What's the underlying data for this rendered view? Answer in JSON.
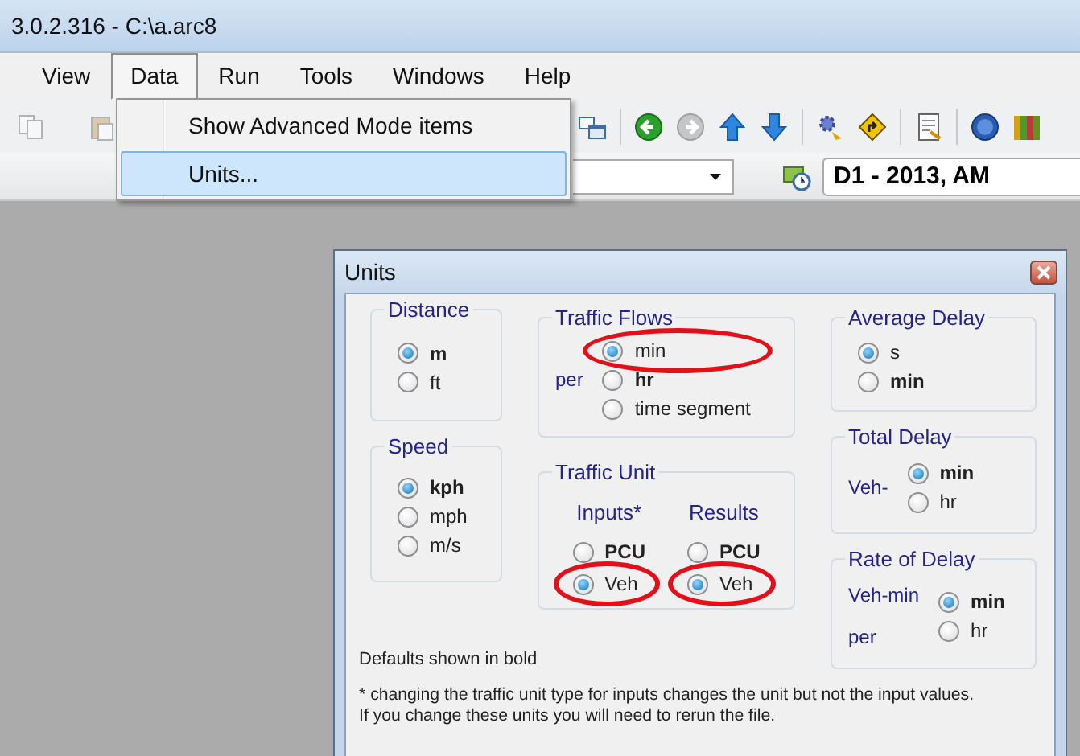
{
  "window": {
    "title": "3.0.2.316 - C:\\a.arc8"
  },
  "menu_bar": [
    {
      "label": "View",
      "selected": false
    },
    {
      "label": "Data",
      "selected": true
    },
    {
      "label": "Run",
      "selected": false
    },
    {
      "label": "Tools",
      "selected": false
    },
    {
      "label": "Windows",
      "selected": false
    },
    {
      "label": "Help",
      "selected": false
    }
  ],
  "data_menu": [
    {
      "label": "Show Advanced Mode items",
      "selected": false
    },
    {
      "label": "Units...",
      "selected": true
    }
  ],
  "analysis_field": {
    "value": "D1 - 2013, AM"
  },
  "units_dialog": {
    "title": "Units",
    "distance": {
      "title": "Distance",
      "options": [
        {
          "label": "m",
          "selected": true,
          "default": true,
          "circled": false
        },
        {
          "label": "ft",
          "selected": false,
          "default": false,
          "circled": false
        }
      ]
    },
    "speed": {
      "title": "Speed",
      "options": [
        {
          "label": "kph",
          "selected": true,
          "default": true,
          "circled": false
        },
        {
          "label": "mph",
          "selected": false,
          "default": false,
          "circled": false
        },
        {
          "label": "m/s",
          "selected": false,
          "default": false,
          "circled": false
        }
      ]
    },
    "traffic_flows": {
      "title": "Traffic Flows",
      "prefix": [
        "per"
      ],
      "options": [
        {
          "label": "min",
          "selected": true,
          "default": false,
          "circled": true
        },
        {
          "label": "hr",
          "selected": false,
          "default": true,
          "circled": false
        },
        {
          "label": "time segment",
          "selected": false,
          "default": false,
          "circled": false
        }
      ]
    },
    "traffic_unit": {
      "title": "Traffic Unit",
      "columns": [
        {
          "heading": "Inputs*",
          "options": [
            {
              "label": "PCU",
              "selected": false,
              "default": true,
              "circled": false
            },
            {
              "label": "Veh",
              "selected": true,
              "default": false,
              "circled": true
            }
          ]
        },
        {
          "heading": "Results",
          "options": [
            {
              "label": "PCU",
              "selected": false,
              "default": true,
              "circled": false
            },
            {
              "label": "Veh",
              "selected": true,
              "default": false,
              "circled": true
            }
          ]
        }
      ]
    },
    "average_delay": {
      "title": "Average Delay",
      "options": [
        {
          "label": "s",
          "selected": true,
          "default": false,
          "circled": false
        },
        {
          "label": "min",
          "selected": false,
          "default": true,
          "circled": false
        }
      ]
    },
    "total_delay": {
      "title": "Total Delay",
      "prefix": [
        "Veh-"
      ],
      "options": [
        {
          "label": "min",
          "selected": true,
          "default": true,
          "circled": false
        },
        {
          "label": "hr",
          "selected": false,
          "default": false,
          "circled": false
        }
      ]
    },
    "rate_of_delay": {
      "title": "Rate of Delay",
      "prefix": [
        "Veh-min",
        "per"
      ],
      "options": [
        {
          "label": "min",
          "selected": true,
          "default": true,
          "circled": false
        },
        {
          "label": "hr",
          "selected": false,
          "default": false,
          "circled": false
        }
      ]
    },
    "defaults_note": "Defaults shown in bold",
    "footnote": [
      "* changing the traffic unit type for inputs changes the unit but not the input values.",
      "If you change these units you will need to rerun the file."
    ]
  }
}
